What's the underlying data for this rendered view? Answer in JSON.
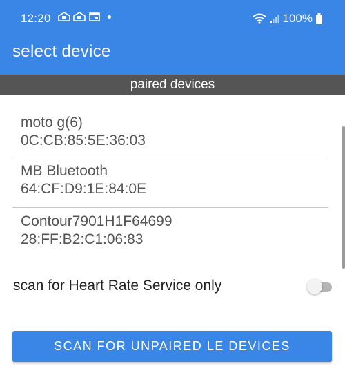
{
  "status_bar": {
    "time": "12:20",
    "battery": "100%",
    "icons": [
      "notification-icon",
      "notification-icon",
      "screen-icon",
      "dot",
      "wifi-icon",
      "signal-icon",
      "battery-icon"
    ]
  },
  "app_bar": {
    "title": "select device"
  },
  "paired_section": {
    "header": "paired devices",
    "devices": [
      {
        "name": "moto g(6)",
        "address": "0C:CB:85:5E:36:03"
      },
      {
        "name": "MB Bluetooth",
        "address": "64:CF:D9:1E:84:0E"
      },
      {
        "name": "Contour7901H1F64699",
        "address": "28:FF:B2:C1:06:83"
      }
    ]
  },
  "filter": {
    "label": "scan for Heart Rate Service only",
    "enabled": false
  },
  "scan_button": {
    "label": "SCAN FOR UNPAIRED LE DEVICES"
  },
  "colors": {
    "primary": "#3a86e6",
    "section_header": "#555555"
  }
}
